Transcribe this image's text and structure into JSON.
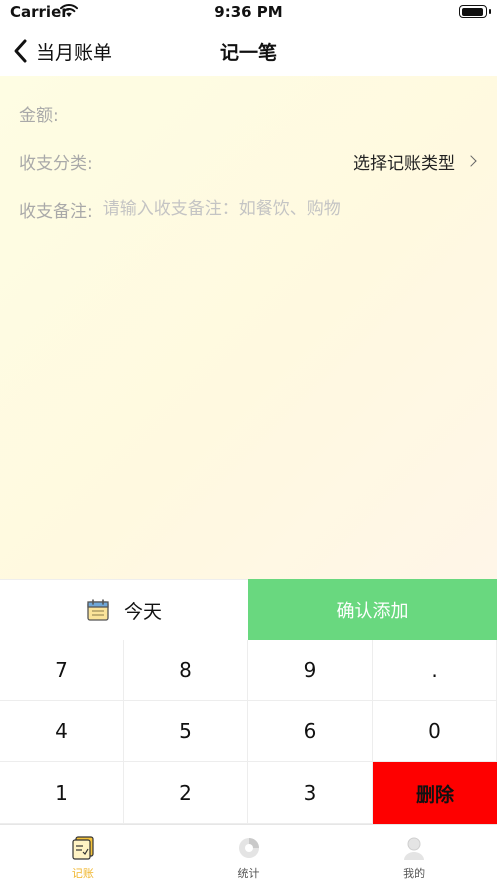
{
  "status_bar": {
    "carrier": "Carrier",
    "time": "9:36 PM"
  },
  "nav": {
    "back_label": "当月账单",
    "title": "记一笔"
  },
  "form": {
    "amount_label": "金额:",
    "category_label": "收支分类:",
    "category_value": "选择记账类型",
    "note_label": "收支备注:",
    "note_placeholder": "请输入收支备注：如餐饮、购物",
    "note_value": ""
  },
  "actions": {
    "date_label": "今天",
    "confirm_label": "确认添加"
  },
  "keypad": {
    "keys": [
      "7",
      "8",
      "9",
      ".",
      "4",
      "5",
      "6",
      "0",
      "1",
      "2",
      "3"
    ],
    "delete_label": "删除"
  },
  "tabs": [
    {
      "label": "记账",
      "icon": "bookkeeping-icon",
      "active": true
    },
    {
      "label": "统计",
      "icon": "statistics-icon",
      "active": false
    },
    {
      "label": "我的",
      "icon": "profile-icon",
      "active": false
    }
  ],
  "colors": {
    "accent": "#f0b62e",
    "confirm": "#69d87f",
    "delete": "#fe0000",
    "background": "#fefde3"
  }
}
